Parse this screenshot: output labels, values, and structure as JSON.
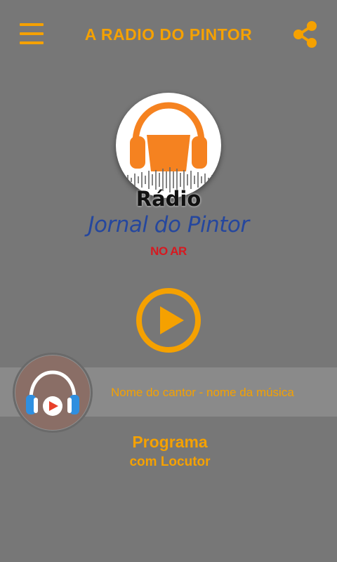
{
  "header": {
    "title": "A RADIO DO PINTOR",
    "menu_icon": "hamburger-menu-icon",
    "share_icon": "share-icon"
  },
  "logo": {
    "line1": "Rádio",
    "line2": "Jornal do Pintor",
    "line3": "NO AR"
  },
  "player": {
    "play_icon": "play-icon",
    "now_playing": "Nome do cantor - nome da música",
    "cover_icon": "headphones-play-icon"
  },
  "program": {
    "title": "Programa",
    "host": "com Locutor"
  },
  "colors": {
    "background": "#777777",
    "accent": "#f5a100",
    "bar": "#8a8a8a",
    "logo_blue": "#25479e",
    "logo_red": "#d71920"
  }
}
